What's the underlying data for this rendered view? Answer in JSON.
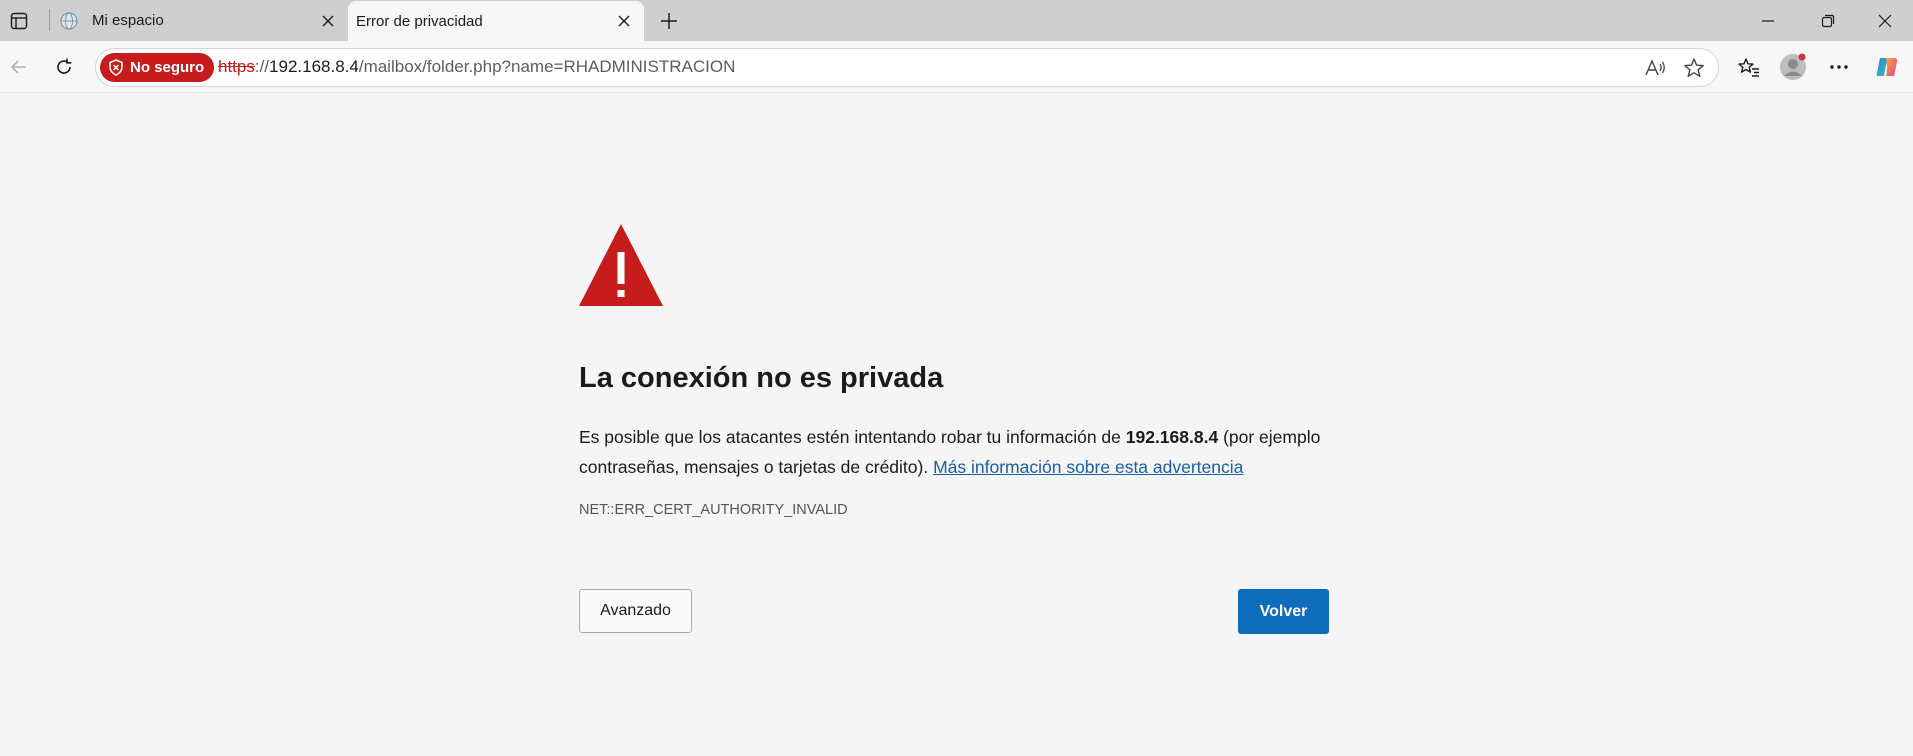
{
  "tabs": [
    {
      "title": "Mi espacio",
      "icon": "globe-icon"
    },
    {
      "title": "Error de privacidad",
      "icon": "none",
      "active": true
    }
  ],
  "address_bar": {
    "security_label": "No seguro",
    "url_scheme": "https",
    "url_separator": "://",
    "url_host": "192.168.8.4",
    "url_path": "/mailbox/folder.php?name=RHADMINISTRACION"
  },
  "page": {
    "heading": "La conexión no es privada",
    "body_before_host": "Es posible que los atacantes estén intentando robar tu información de ",
    "host": "192.168.8.4",
    "body_after_host": " (por ejemplo contraseñas, mensajes o tarjetas de crédito). ",
    "more_info_link": "Más información sobre esta advertencia",
    "error_code": "NET::ERR_CERT_AUTHORITY_INVALID",
    "advanced_button": "Avanzado",
    "back_button": "Volver"
  },
  "colors": {
    "warning_red": "#c61c1c",
    "primary_blue": "#0f6cbd",
    "link_blue": "#1a5fa8"
  }
}
